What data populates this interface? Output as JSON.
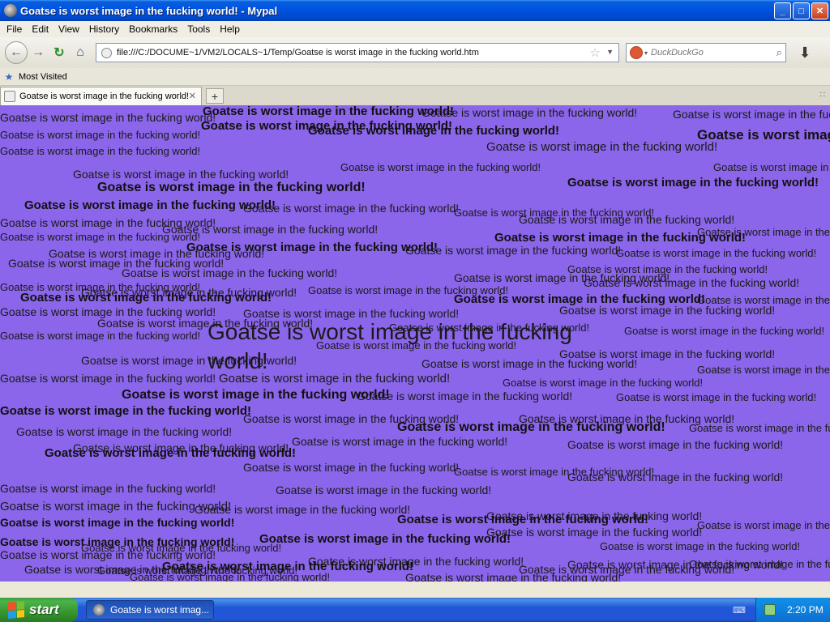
{
  "window": {
    "title": "Goatse is worst image in the fucking world! - Mypal",
    "controls": {
      "minimize": "_",
      "maximize": "□",
      "close": "✕"
    }
  },
  "menu": [
    "File",
    "Edit",
    "View",
    "History",
    "Bookmarks",
    "Tools",
    "Help"
  ],
  "nav": {
    "url": "file:///C:/DOCUME~1/VM2/LOCALS~1/Temp/Goatse is worst image in the fucking world.htm",
    "search_placeholder": "DuckDuckGo"
  },
  "bookmarks": {
    "most_visited": "Most Visited"
  },
  "tabs": [
    {
      "label": "Goatse is worst image in the fucking world!"
    }
  ],
  "content": {
    "background": "#8b65ea",
    "phrase": "Goatse is worst image in the fucking world!"
  },
  "taskbar": {
    "start_label": "start",
    "task_item": "Goatse is worst imag...",
    "clock": "2:20 PM"
  }
}
